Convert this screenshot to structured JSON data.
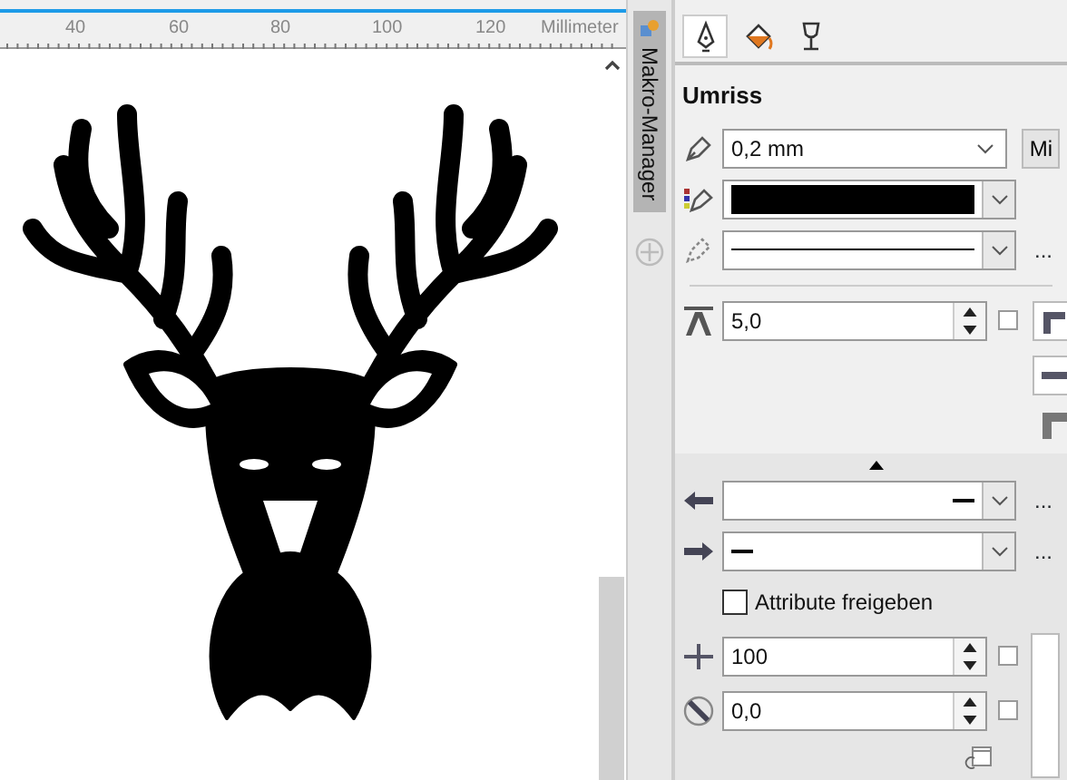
{
  "ruler": {
    "labels": [
      "40",
      "60",
      "80",
      "100",
      "120"
    ],
    "unit": "Millimeter"
  },
  "docker_tabs": [
    {
      "label": "Makro-Manager",
      "selected": true
    }
  ],
  "panel": {
    "tabs": [
      {
        "kind": "pen",
        "selected": true
      },
      {
        "kind": "fill",
        "selected": false
      },
      {
        "kind": "glass",
        "selected": false
      }
    ],
    "section_title": "Umriss",
    "width": {
      "value": "0,2 mm",
      "unit_button": "Mi"
    },
    "style_more": "...",
    "miter": {
      "value": "5,0",
      "checked": false
    },
    "start_arrow_more": "...",
    "end_arrow_more": "...",
    "share_attributes": {
      "label": "Attribute freigeben",
      "checked": false
    },
    "scale": {
      "value": "100",
      "checked": false
    },
    "angle": {
      "value": "0,0",
      "checked": false
    }
  }
}
